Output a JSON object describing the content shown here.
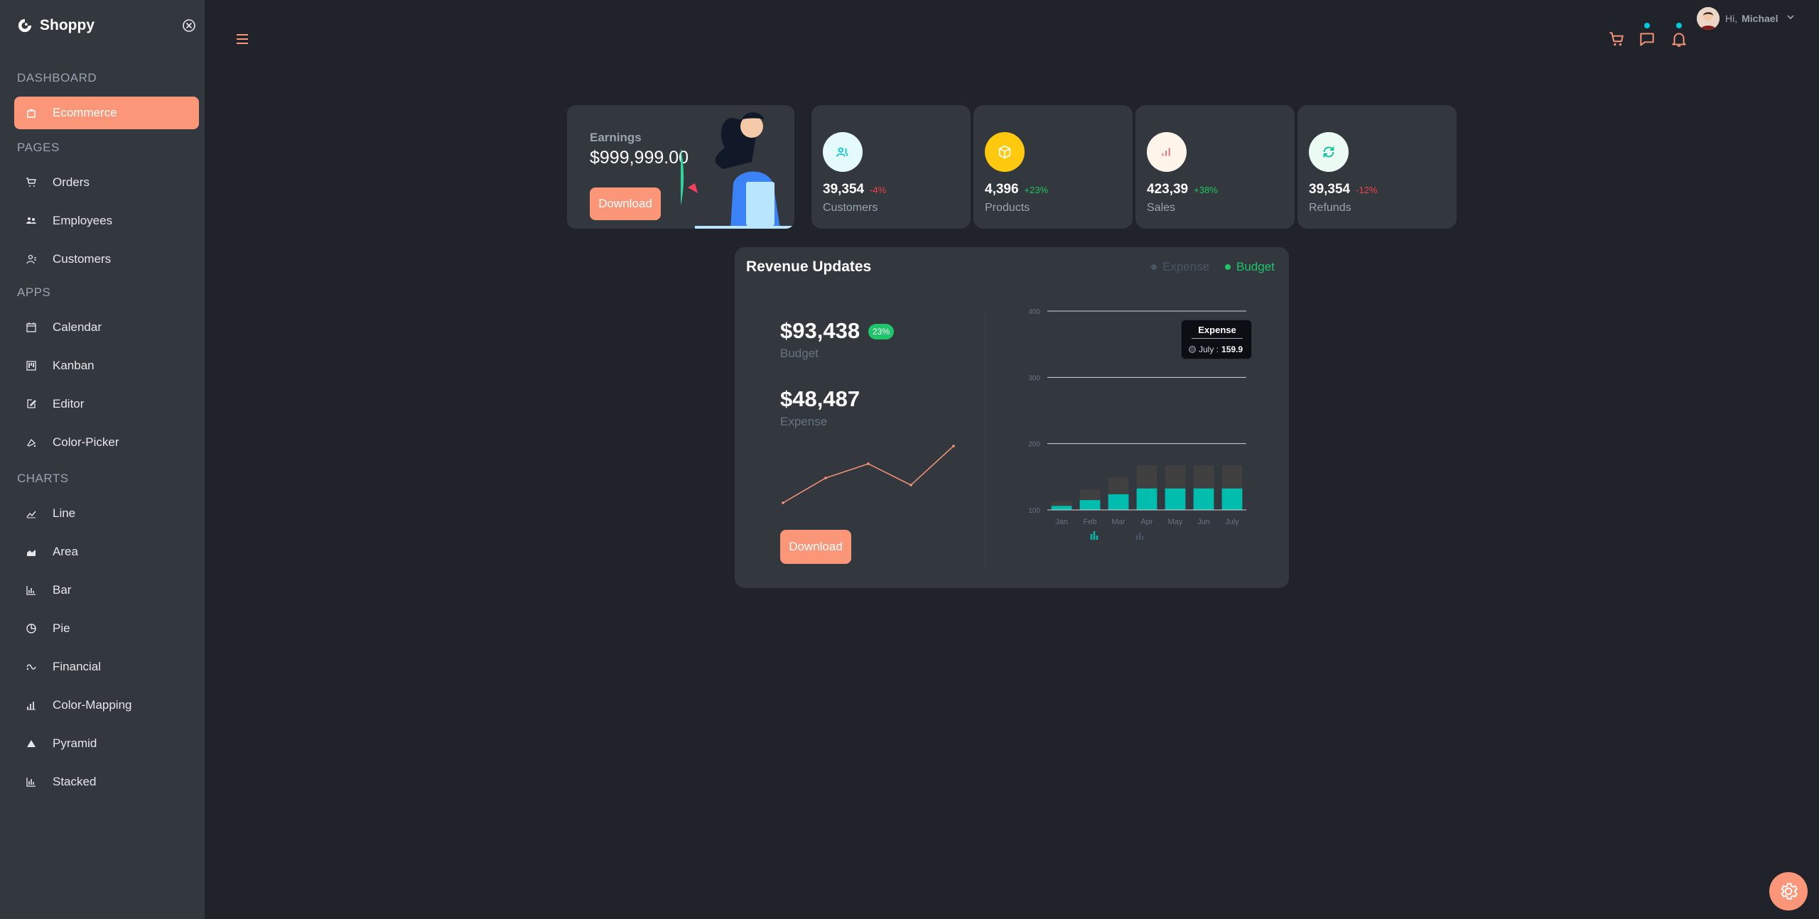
{
  "brand": {
    "name": "Shoppy"
  },
  "sidebar": {
    "sections": [
      {
        "title": "DASHBOARD",
        "items": [
          {
            "label": "Ecommerce",
            "icon": "shopping-bag-icon",
            "active": true
          }
        ]
      },
      {
        "title": "PAGES",
        "items": [
          {
            "label": "Orders",
            "icon": "cart-icon"
          },
          {
            "label": "Employees",
            "icon": "people-icon"
          },
          {
            "label": "Customers",
            "icon": "user-icon"
          }
        ]
      },
      {
        "title": "APPS",
        "items": [
          {
            "label": "Calendar",
            "icon": "calendar-icon"
          },
          {
            "label": "Kanban",
            "icon": "kanban-icon"
          },
          {
            "label": "Editor",
            "icon": "edit-icon"
          },
          {
            "label": "Color-Picker",
            "icon": "color-picker-icon"
          }
        ]
      },
      {
        "title": "CHARTS",
        "items": [
          {
            "label": "Line",
            "icon": "line-chart-icon"
          },
          {
            "label": "Area",
            "icon": "area-chart-icon"
          },
          {
            "label": "Bar",
            "icon": "bar-chart-icon"
          },
          {
            "label": "Pie",
            "icon": "pie-chart-icon"
          },
          {
            "label": "Financial",
            "icon": "financial-icon"
          },
          {
            "label": "Color-Mapping",
            "icon": "color-mapping-icon"
          },
          {
            "label": "Pyramid",
            "icon": "pyramid-icon"
          },
          {
            "label": "Stacked",
            "icon": "stacked-icon"
          }
        ]
      }
    ]
  },
  "header": {
    "greeting": "Hi,",
    "user": "Michael"
  },
  "earnings": {
    "label": "Earnings",
    "value": "$999,999.00",
    "button": "Download"
  },
  "stats": [
    {
      "value": "39,354",
      "pct": "-4%",
      "pct_color": "#ef4444",
      "title": "Customers",
      "icon": "customers-icon",
      "icon_bg": "#e5fafb",
      "icon_color": "#03c9d7"
    },
    {
      "value": "4,396",
      "pct": "+23%",
      "pct_color": "#22c55e",
      "title": "Products",
      "icon": "box-icon",
      "icon_bg": "#fec90f",
      "icon_color": "#ffffff"
    },
    {
      "value": "423,39",
      "pct": "+38%",
      "pct_color": "#22c55e",
      "title": "Sales",
      "icon": "sales-icon",
      "icon_bg": "#fff4ea",
      "icon_color": "#e46a76"
    },
    {
      "value": "39,354",
      "pct": "-12%",
      "pct_color": "#ef4444",
      "title": "Refunds",
      "icon": "refund-icon",
      "icon_bg": "#ebfaf2",
      "icon_color": "#00c292"
    }
  ],
  "revenue": {
    "title": "Revenue Updates",
    "legend": [
      {
        "label": "Expense",
        "color": "#4b5563"
      },
      {
        "label": "Budget",
        "color": "#1fc46b"
      }
    ],
    "budget_value": "$93,438",
    "budget_pct": "23%",
    "budget_label": "Budget",
    "expense_value": "$48,487",
    "expense_label": "Expense",
    "button": "Download",
    "tooltip": {
      "title": "Expense",
      "label": "July :",
      "value": "159.9"
    }
  },
  "chart_data": {
    "type": "bar",
    "stacked": true,
    "categories": [
      "Jan",
      "Feb",
      "Mar",
      "Apr",
      "May",
      "Jun",
      "July"
    ],
    "yticks": [
      100,
      200,
      300,
      400
    ],
    "ylim": [
      100,
      400
    ],
    "series": [
      {
        "name": "Budget",
        "color": "#00bdae",
        "values": [
          111,
          127,
          143,
          159,
          159,
          159,
          159
        ]
      },
      {
        "name": "Expense",
        "color": "#404041",
        "values": [
          111,
          127,
          143,
          159,
          159,
          159,
          159
        ]
      }
    ],
    "sparkline": [
      0,
      35,
      55,
      25,
      80
    ]
  },
  "colors": {
    "accent": "#fb9678",
    "teal": "#03c9d7"
  }
}
